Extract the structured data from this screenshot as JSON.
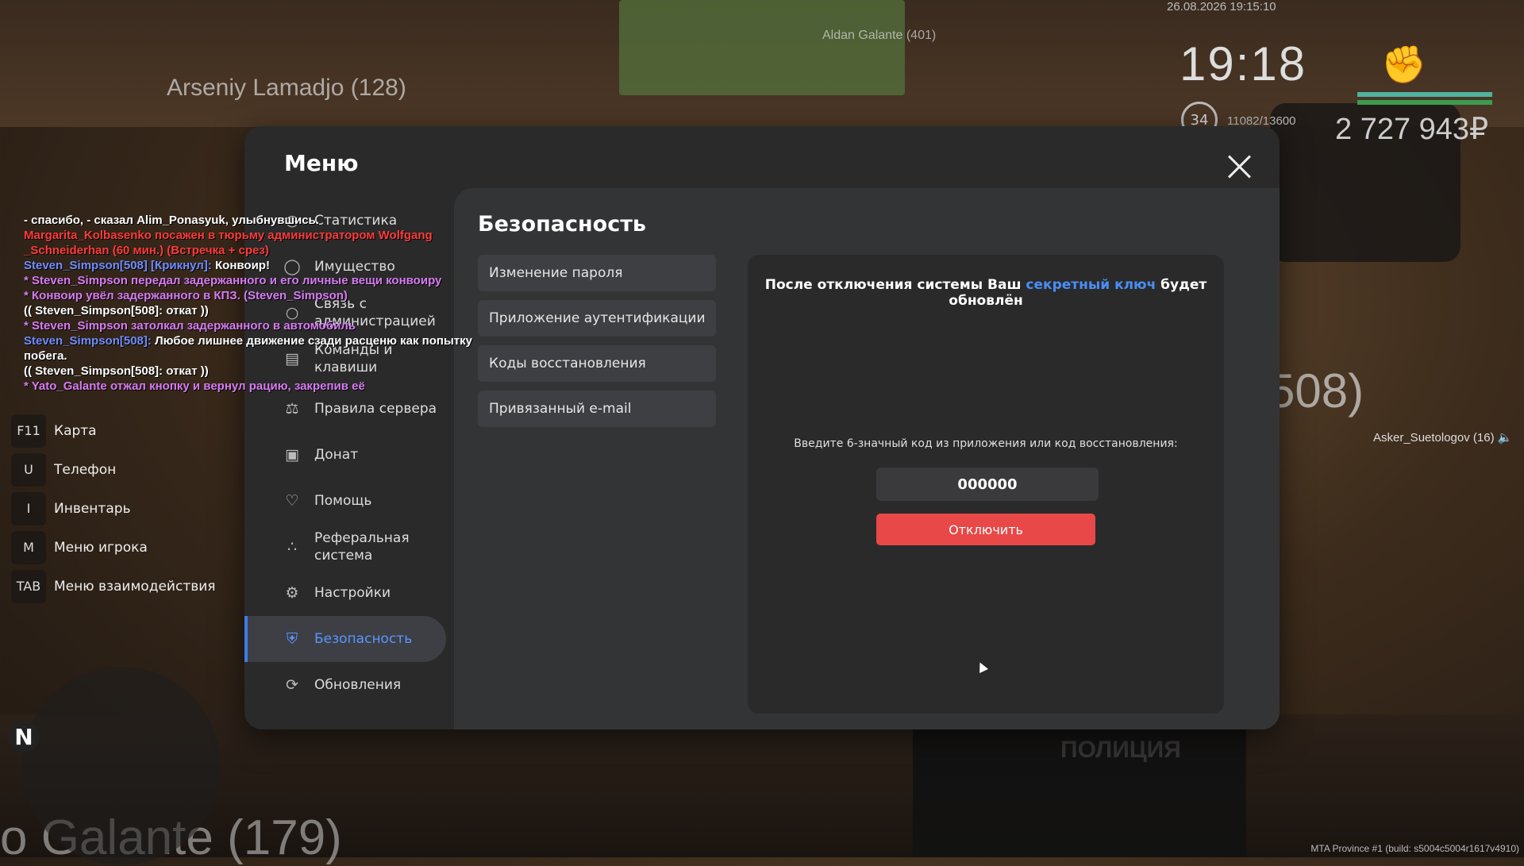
{
  "hud": {
    "datetime": "26.08.2026 19:15:10",
    "clock": "19:18",
    "level": "34",
    "xp": "11082/13600",
    "money": "2 727 943₽",
    "bar_colors": [
      "#4fb3a0",
      "#3c9b4e"
    ]
  },
  "world": {
    "player_top": "Arseniy Lamadjo (128)",
    "player_center": "Aldan Galante (401)",
    "player_right": "Asker_Suetologov (16)",
    "player_right_big": "508)",
    "player_bottom": "o Galante (179)",
    "police_text": "ПОЛИЦИЯ",
    "build": "MTA Province #1 (build: s5004c5004r1617v4910)"
  },
  "chat": [
    {
      "text": "- спасибо, - сказал Alim_Ponasyuk, улыбнувшись.",
      "color": "#ffffff"
    },
    {
      "text": "Margarita_Kolbasenko посажен в тюрьму администратором Wolfgang",
      "color": "#ff3b3b"
    },
    {
      "text": "_Schneiderhan (60 мин.) (Встречка + срез)",
      "color": "#ff3b3b"
    },
    {
      "text": "Steven_Simpson[508] [Крикнул]: ",
      "color": "#6f8cff",
      "tail": "Конвоир!",
      "tail_color": "#ffffff"
    },
    {
      "text": "* Steven_Simpson передал задержанного и его личные вещи конвоиру",
      "color": "#d77cf2"
    },
    {
      "text": "* Конвоир увёл задержанного в КПЗ. (Steven_Simpson)",
      "color": "#d77cf2"
    },
    {
      "text": "(( Steven_Simpson[508]: откат ))",
      "color": "#ffffff"
    },
    {
      "text": "* Steven_Simpson затолкал задержанного в автомобиль",
      "color": "#d77cf2"
    },
    {
      "text": "Steven_Simpson[508]: ",
      "color": "#6f8cff",
      "tail": "Любое лишнее движение сзади расценю как попытку",
      "tail_color": "#ffffff"
    },
    {
      "text": " побега.",
      "color": "#ffffff"
    },
    {
      "text": "(( Steven_Simpson[508]: откат ))",
      "color": "#ffffff"
    },
    {
      "text": "* Yato_Galante отжал кнопку и вернул рацию, закрепив её",
      "color": "#d77cf2"
    }
  ],
  "keybinds": [
    {
      "key": "F11",
      "label": "Карта"
    },
    {
      "key": "U",
      "label": "Телефон"
    },
    {
      "key": "I",
      "label": "Инвентарь"
    },
    {
      "key": "M",
      "label": "Меню игрока"
    },
    {
      "key": "TAB",
      "label": "Меню взаимодействия"
    }
  ],
  "compass": "N",
  "menu": {
    "title": "Меню",
    "sidebar": [
      {
        "label": "Статистика",
        "icon": "stats-icon"
      },
      {
        "label": "Имущество",
        "icon": "property-icon"
      },
      {
        "label": "Связь с администрацией",
        "icon": "chat-icon"
      },
      {
        "label": "Команды и клавиши",
        "icon": "list-icon"
      },
      {
        "label": "Правила сервера",
        "icon": "scales-icon"
      },
      {
        "label": "Донат",
        "icon": "wallet-icon"
      },
      {
        "label": "Помощь",
        "icon": "heart-hand-icon"
      },
      {
        "label": "Реферальная система",
        "icon": "referral-icon"
      },
      {
        "label": "Настройки",
        "icon": "gear-icon"
      },
      {
        "label": "Безопасность",
        "icon": "shield-icon",
        "active": true
      },
      {
        "label": "Обновления",
        "icon": "update-icon"
      }
    ],
    "section_title": "Безопасность",
    "sub_items": [
      "Изменение пароля",
      "Приложение аутентификации",
      "Коды восстановления",
      "Привязанный e-mail"
    ],
    "panel": {
      "head_before": "После отключения системы Ваш ",
      "head_link": "секретный ключ",
      "head_after": " будет обновлён",
      "hint": "Введите 6-значный код из приложения или код восстановления:",
      "code_value": "000000",
      "button": "Отключить",
      "accent": "#4a8ef5",
      "button_color": "#e84848"
    }
  }
}
